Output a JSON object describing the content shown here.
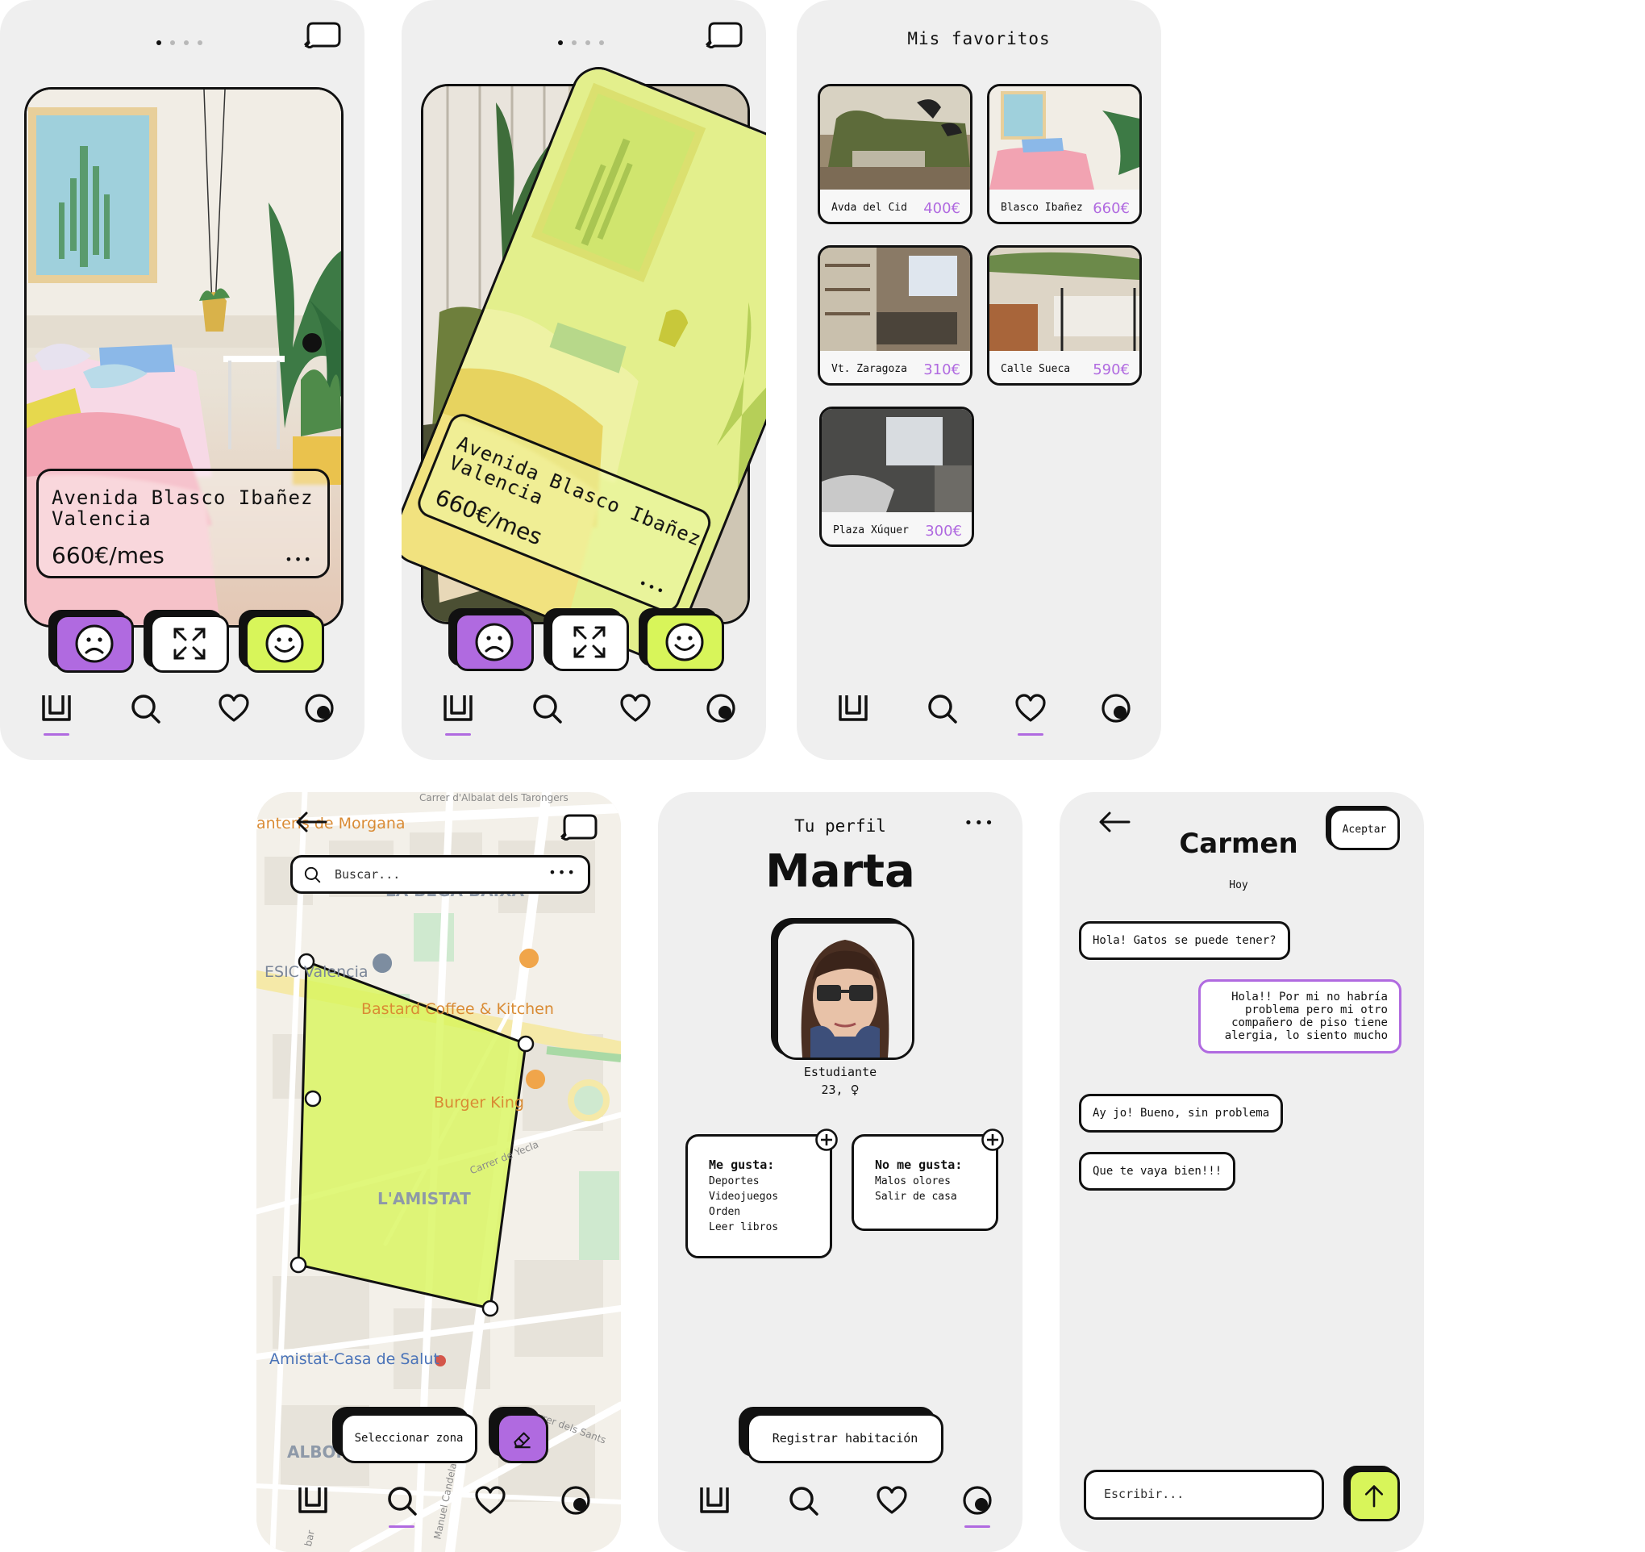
{
  "colors": {
    "accent_purple": "#b06ae0",
    "accent_lime": "#d8f55a",
    "dark": "#111111",
    "panel": "#efefef"
  },
  "swipe1": {
    "address_line1": "Avenida Blasco Ibañez",
    "address_line2": "Valencia",
    "price": "660€/mes",
    "more": "•••"
  },
  "swipe2": {
    "address_line1": "Avenida Blasco Ibañez",
    "address_line2": "Valencia",
    "price": "660€/mes",
    "more": "•••"
  },
  "favorites": {
    "title": "Mis favoritos",
    "items": [
      {
        "name": "Avda del Cid",
        "price": "400€"
      },
      {
        "name": "Blasco Ibañez",
        "price": "660€"
      },
      {
        "name": "Vt. Zaragoza",
        "price": "310€"
      },
      {
        "name": "Calle Sueca",
        "price": "590€"
      },
      {
        "name": "Plaza Xúquer",
        "price": "300€"
      }
    ]
  },
  "map": {
    "search_placeholder": "Buscar...",
    "more": "•••",
    "labels": {
      "street_top": "Carrer d'Albalat dels Tarongers",
      "poi_morgana": "anteris de Morgana",
      "district_bega": "LA BEGA BAIXA",
      "poi_esic": "ESIC Valencia",
      "poi_bastard": "Bastard Coffee & Kitchen",
      "poi_burger": "Burger King",
      "street_yecla": "Carrer de Yecla",
      "district_amistat": "L'AMISTAT",
      "poi_salut": "Amistat-Casa de Salut",
      "district_albor": "ALBOR",
      "street_sants": "Carrer dels Sants Just",
      "street_candela": "Manuel Candela",
      "street_bar": "bar"
    },
    "select_zone_label": "Seleccionar zona"
  },
  "profile": {
    "header": "Tu perfil",
    "more": "•••",
    "name": "Marta",
    "role": "Estudiante",
    "age": "23,",
    "gender_symbol": "♀",
    "likes_title": "Me gusta:",
    "likes": [
      "Deportes",
      "Videojuegos",
      "Orden",
      "Leer libros"
    ],
    "dislikes_title": "No me gusta:",
    "dislikes": [
      "Malos olores",
      "Salir de casa"
    ],
    "register_label": "Registrar habitación"
  },
  "chat": {
    "contact_name": "Carmen",
    "accept_label": "Aceptar",
    "date_label": "Hoy",
    "messages": [
      {
        "from": "them",
        "text": "Hola! Gatos se puede tener?"
      },
      {
        "from": "me",
        "text": "Hola!! Por mi no habría problema pero mi otro compañero de piso tiene alergia, lo siento mucho"
      },
      {
        "from": "them",
        "text": "Ay jo! Bueno, sin problema"
      },
      {
        "from": "them",
        "text": "Que te vaya bien!!!"
      }
    ],
    "input_placeholder": "Escribir..."
  },
  "nav": {
    "items": [
      {
        "icon": "home-icon"
      },
      {
        "icon": "search-icon"
      },
      {
        "icon": "heart-icon"
      },
      {
        "icon": "profile-icon"
      }
    ]
  }
}
